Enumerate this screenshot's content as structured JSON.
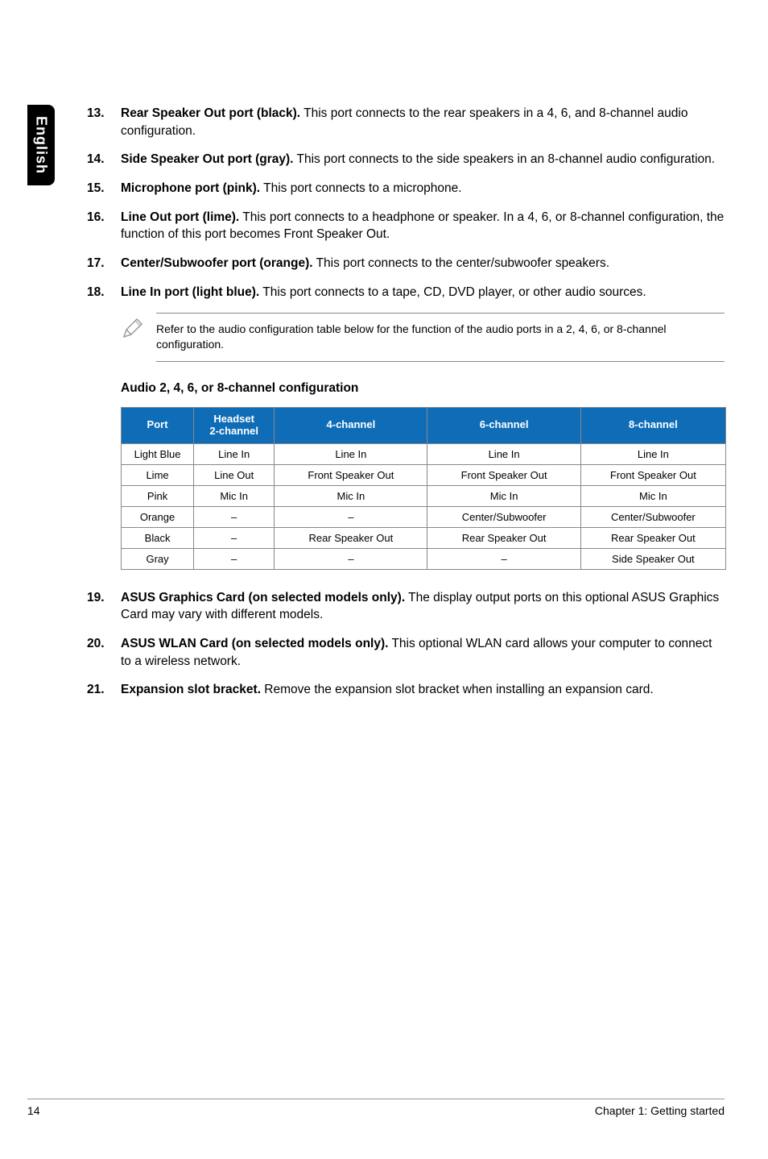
{
  "sideTab": "English",
  "items": [
    {
      "num": "13.",
      "bold": "Rear Speaker Out port (black).",
      "rest": " This port connects to the rear speakers in a 4, 6, and 8-channel audio configuration."
    },
    {
      "num": "14.",
      "bold": "Side Speaker Out port (gray).",
      "rest": " This port connects to the side speakers in an 8-channel audio configuration."
    },
    {
      "num": "15.",
      "bold": "Microphone port (pink).",
      "rest": " This port connects to a microphone."
    },
    {
      "num": "16.",
      "bold": "Line Out port (lime).",
      "rest": " This port connects to a headphone or speaker. In a 4, 6, or 8-channel configuration, the function of this port becomes Front Speaker Out."
    },
    {
      "num": "17.",
      "bold": "Center/Subwoofer port (orange).",
      "rest": " This port connects to the center/subwoofer speakers."
    },
    {
      "num": "18.",
      "bold": "Line In port (light blue).",
      "rest": " This port connects to a tape, CD, DVD player, or other audio sources."
    }
  ],
  "note": "Refer to the audio configuration table below for the function of the audio ports in a 2, 4, 6, or 8-channel configuration.",
  "subheading": "Audio 2, 4, 6, or 8-channel configuration",
  "table": {
    "headers": [
      "Port",
      "Headset\n2-channel",
      "4-channel",
      "6-channel",
      "8-channel"
    ],
    "rows": [
      [
        "Light Blue",
        "Line In",
        "Line In",
        "Line In",
        "Line In"
      ],
      [
        "Lime",
        "Line Out",
        "Front Speaker Out",
        "Front Speaker Out",
        "Front Speaker Out"
      ],
      [
        "Pink",
        "Mic In",
        "Mic In",
        "Mic In",
        "Mic In"
      ],
      [
        "Orange",
        "–",
        "–",
        "Center/Subwoofer",
        "Center/Subwoofer"
      ],
      [
        "Black",
        "–",
        "Rear Speaker Out",
        "Rear Speaker Out",
        "Rear Speaker Out"
      ],
      [
        "Gray",
        "–",
        "–",
        "–",
        "Side Speaker Out"
      ]
    ]
  },
  "items2": [
    {
      "num": "19.",
      "bold": "ASUS Graphics Card (on selected models only).",
      "rest": " The display output ports on this optional ASUS Graphics Card may vary with different models."
    },
    {
      "num": "20.",
      "bold": "ASUS WLAN Card (on selected models only).",
      "rest": " This optional WLAN card allows your computer to connect to a wireless network."
    },
    {
      "num": "21.",
      "bold": "Expansion slot bracket.",
      "rest": " Remove the expansion slot bracket when installing an expansion card."
    }
  ],
  "footer": {
    "page": "14",
    "chapter": "Chapter 1: Getting started"
  }
}
